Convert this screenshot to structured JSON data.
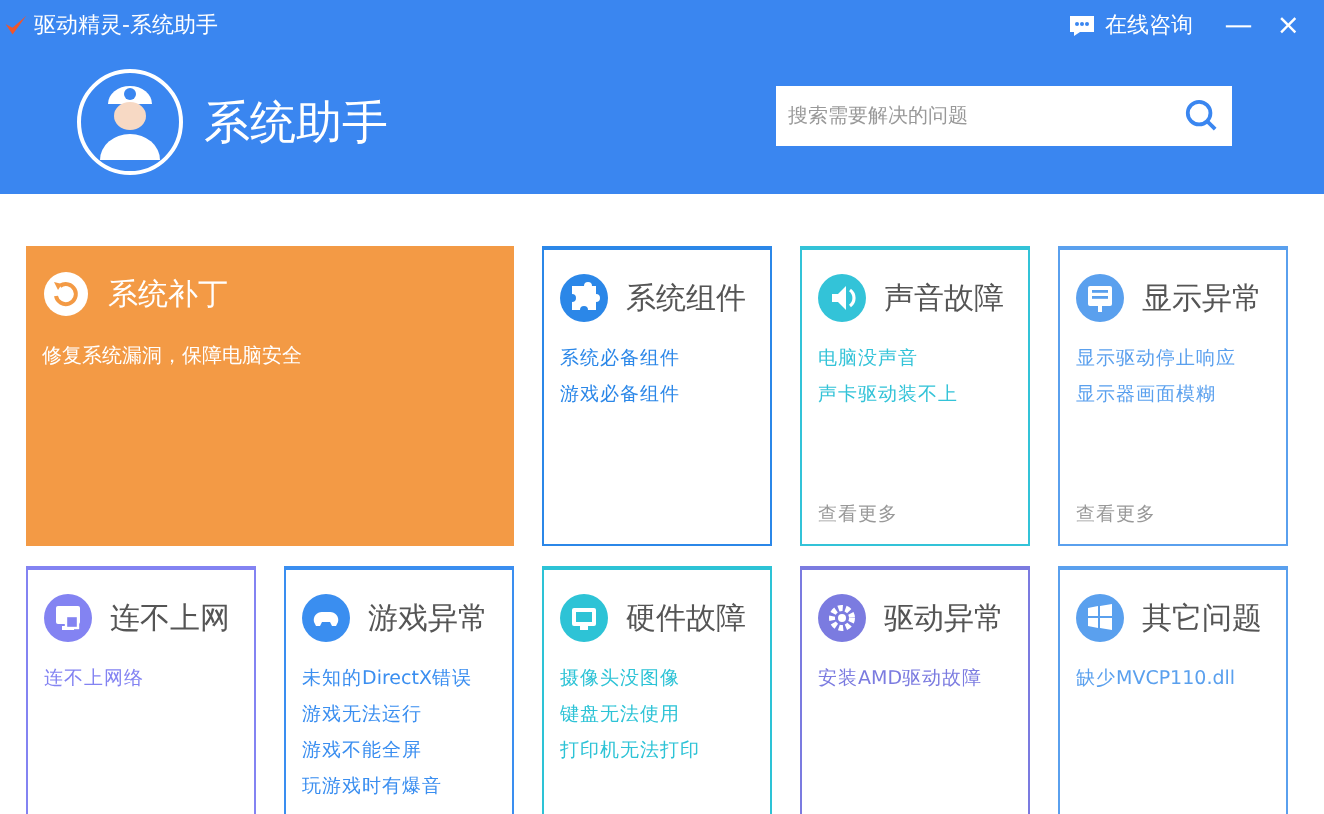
{
  "window": {
    "title": "驱动精灵-系统助手",
    "consult": "在线咨询",
    "minimize": "—",
    "close": "×"
  },
  "header": {
    "title": "系统助手",
    "search": {
      "placeholder": "搜索需要解决的问题"
    }
  },
  "featured": {
    "title": "系统补丁",
    "description": "修复系统漏洞，保障电脑安全"
  },
  "cards": [
    {
      "title": "系统组件",
      "color": "#2b87e8",
      "links": [
        "系统必备组件",
        "游戏必备组件"
      ]
    },
    {
      "title": "声音故障",
      "color": "#33c3d8",
      "links": [
        "电脑没声音",
        "声卡驱动装不上"
      ],
      "more": "查看更多"
    },
    {
      "title": "显示异常",
      "color": "#5aa0ee",
      "links": [
        "显示驱动停止响应",
        "显示器画面模糊"
      ],
      "more": "查看更多"
    },
    {
      "title": "连不上网",
      "color": "#8383f2",
      "links": [
        "连不上网络"
      ]
    },
    {
      "title": "游戏异常",
      "color": "#3a8ef0",
      "links": [
        "未知的DirectX错误",
        "游戏无法运行",
        "游戏不能全屏",
        "玩游戏时有爆音"
      ]
    },
    {
      "title": "硬件故障",
      "color": "#2dc3d6",
      "links": [
        "摄像头没图像",
        "键盘无法使用",
        "打印机无法打印"
      ]
    },
    {
      "title": "驱动异常",
      "color": "#7b7be0",
      "links": [
        "安装AMD驱动故障"
      ]
    },
    {
      "title": "其它问题",
      "color": "#5aa0ee",
      "links": [
        "缺少MVCP110.dll"
      ]
    }
  ]
}
